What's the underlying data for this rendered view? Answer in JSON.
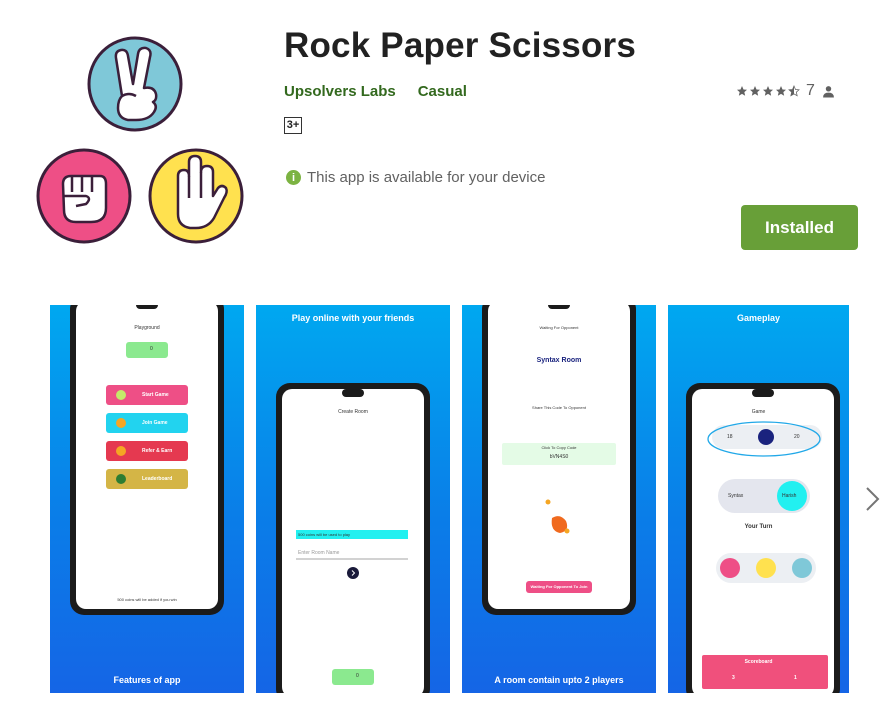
{
  "app": {
    "title": "Rock Paper Scissors",
    "developer": "Upsolvers Labs",
    "category": "Casual",
    "content_rating": "3+",
    "rating_count": "7",
    "rating_stars": 4.5,
    "availability": "This app is available for your device",
    "install_button": "Installed",
    "icon_name": "rock-paper-scissors-app-icon"
  },
  "colors": {
    "developer_green": "#33691e",
    "installed_green": "#689f38",
    "info_green": "#7cb342",
    "shot_blue": "#0a7de8"
  },
  "screenshots": [
    {
      "top_caption": "",
      "bottom_caption": "Features of app",
      "screen_title": "Playground",
      "coins": "0",
      "buttons": [
        "Start Game",
        "Join Game",
        "Refer & Earn",
        "Leaderboard"
      ],
      "footer_note": "500 coins will be added if you win"
    },
    {
      "top_caption": "Play online with your friends",
      "bottom_caption": "",
      "screen_title": "Create Room",
      "notice": "500 coins will be used to play",
      "input_placeholder": "Enter Room Name",
      "coins": "0"
    },
    {
      "top_caption": "",
      "bottom_caption": "A room contain upto 2 players",
      "screen_title": "Waiting For Opponent",
      "room_name": "Syntax Room",
      "share_note": "Share This Code To Opponent",
      "copy_label": "Click To Copy Code",
      "room_code": "bVN4S0",
      "waiting_button": "Waiting For Opponent To Join"
    },
    {
      "top_caption": "Gameplay",
      "bottom_caption": "",
      "screen_title": "Game",
      "score_left": "18",
      "score_right": "20",
      "player_left": "Syntax",
      "player_right": "Harish",
      "turn_label": "Your Turn",
      "scoreboard_label": "Scoreboard",
      "scoreboard_left": "3",
      "scoreboard_right": "1"
    }
  ]
}
